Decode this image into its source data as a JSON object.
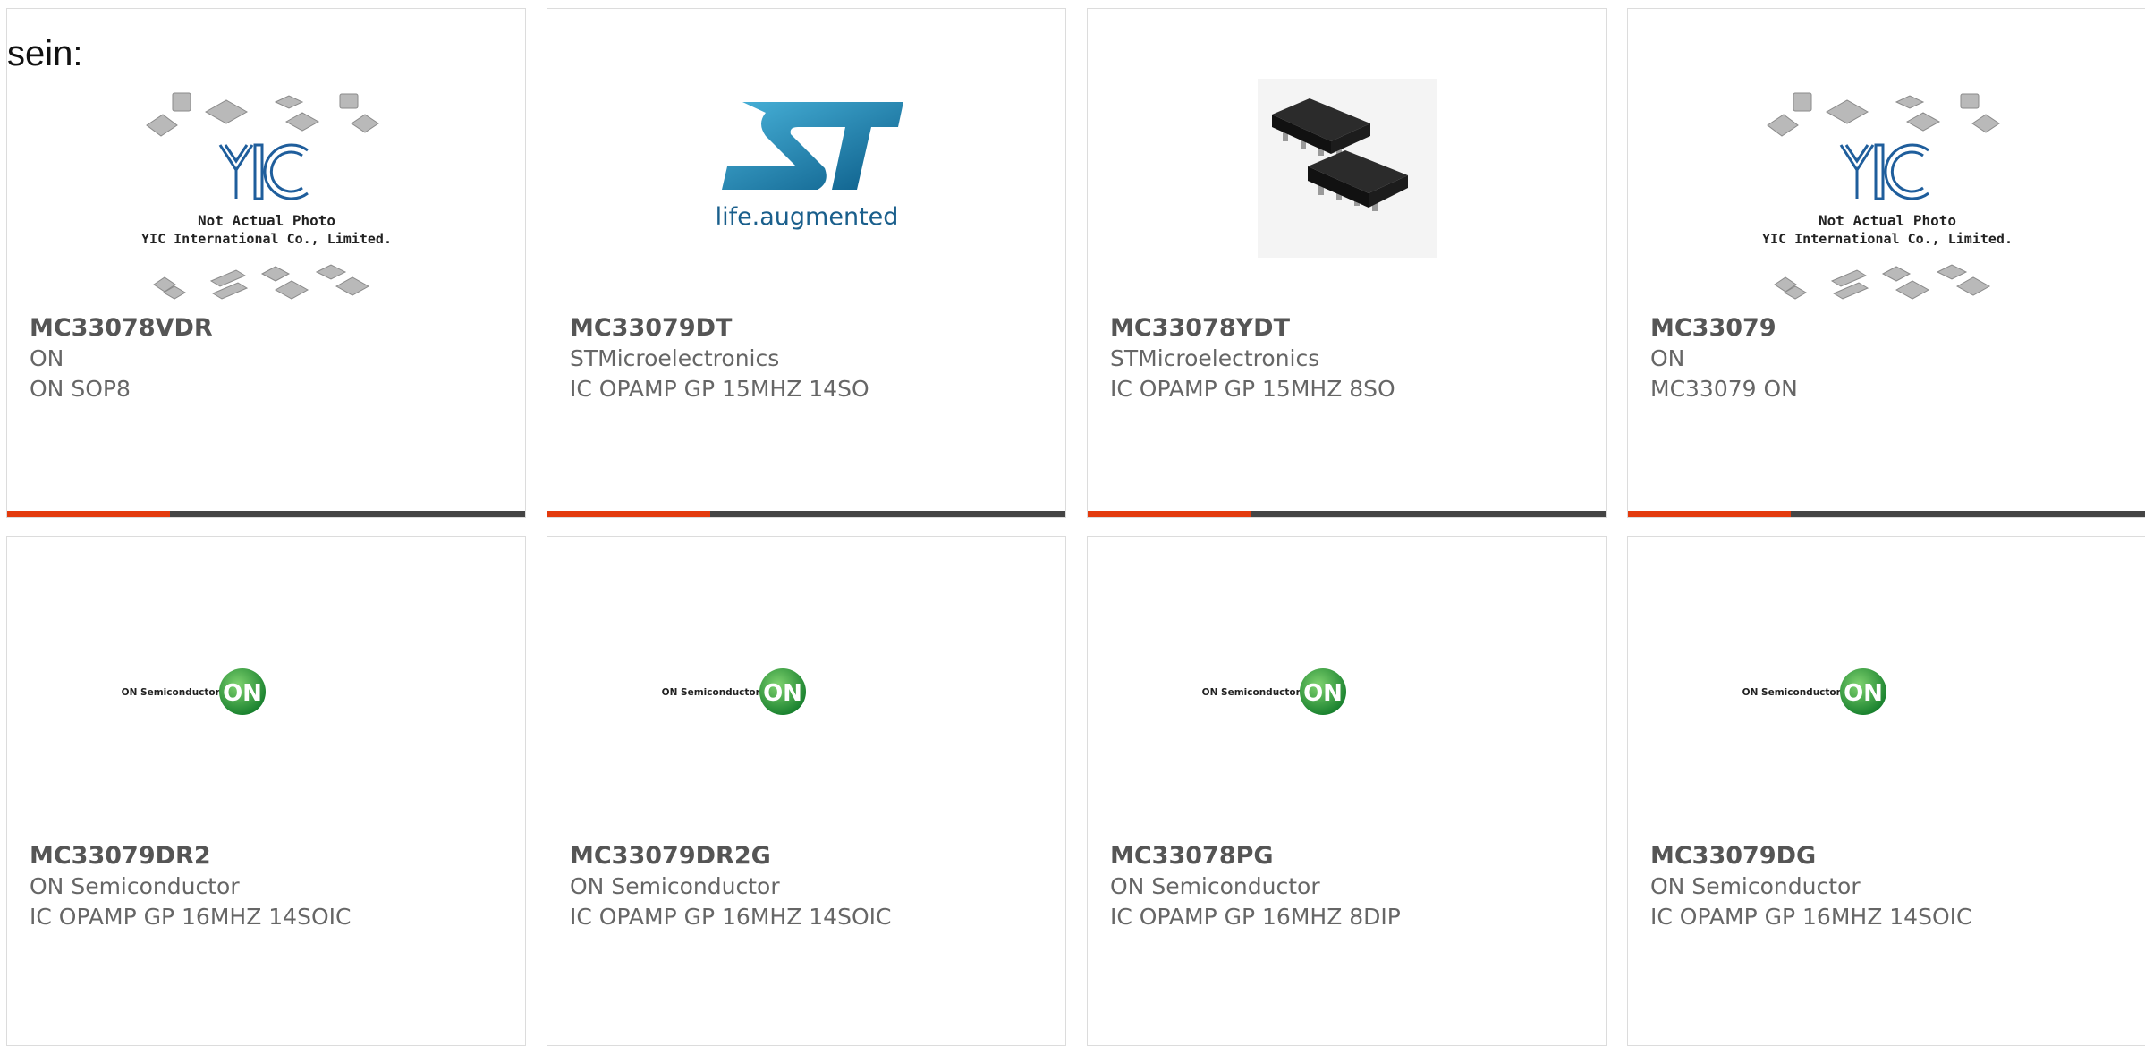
{
  "page": {
    "intro_text": "sein:",
    "accent_color": "#e33a0d",
    "bar_color": "#444444"
  },
  "cards": [
    {
      "part_number": "MC33078VDR",
      "manufacturer": "ON",
      "description": "ON SOP8",
      "image": "yic-placeholder",
      "logo_text": "Not Actual Photo",
      "logo_text2": "YIC International Co., Limited."
    },
    {
      "part_number": "MC33079DT",
      "manufacturer": "STMicroelectronics",
      "description": "IC OPAMP GP 15MHZ 14SO",
      "image": "st-logo",
      "logo_text": "life.augmented"
    },
    {
      "part_number": "MC33078YDT",
      "manufacturer": "STMicroelectronics",
      "description": "IC OPAMP GP 15MHZ 8SO",
      "image": "soic8-chip"
    },
    {
      "part_number": "MC33079",
      "manufacturer": "ON",
      "description": "MC33079 ON",
      "image": "yic-placeholder",
      "logo_text": "Not Actual Photo",
      "logo_text2": "YIC International Co., Limited."
    },
    {
      "part_number": "MC33079DR2",
      "manufacturer": "ON Semiconductor",
      "description": "IC OPAMP GP 16MHZ 14SOIC",
      "image": "onsemi-logo",
      "logo_text": "ON Semiconductor®",
      "logo_badge": "ON"
    },
    {
      "part_number": "MC33079DR2G",
      "manufacturer": "ON Semiconductor",
      "description": "IC OPAMP GP 16MHZ 14SOIC",
      "image": "onsemi-logo",
      "logo_text": "ON Semiconductor®",
      "logo_badge": "ON"
    },
    {
      "part_number": "MC33078PG",
      "manufacturer": "ON Semiconductor",
      "description": "IC OPAMP GP 16MHZ 8DIP",
      "image": "onsemi-logo",
      "logo_text": "ON Semiconductor®",
      "logo_badge": "ON"
    },
    {
      "part_number": "MC33079DG",
      "manufacturer": "ON Semiconductor",
      "description": "IC OPAMP GP 16MHZ 14SOIC",
      "image": "onsemi-logo",
      "logo_text": "ON Semiconductor®",
      "logo_badge": "ON"
    }
  ]
}
